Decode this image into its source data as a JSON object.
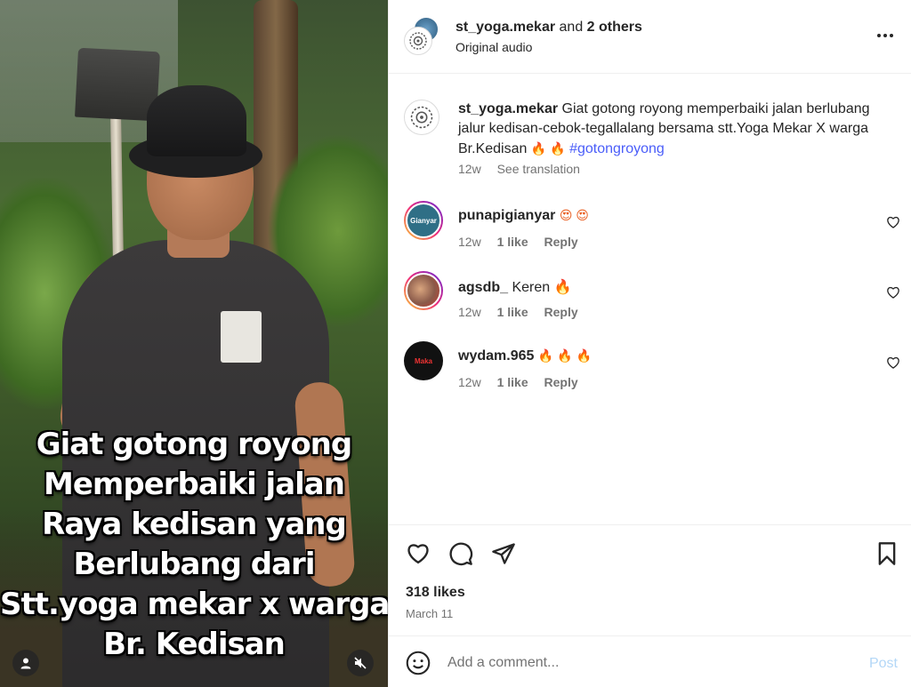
{
  "video": {
    "overlay_lines": [
      "Giat gotong royong",
      "Memperbaiki jalan",
      "Raya kedisan yang",
      "Berlubang dari",
      "Stt.yoga mekar x warga",
      "Br. Kedisan"
    ],
    "user_icon": "user-tag-icon",
    "mute_icon": "muted-speaker-icon"
  },
  "header": {
    "username": "st_yoga.mekar",
    "and_text": "and",
    "others": "2 others",
    "audio": "Original audio",
    "more_icon": "more-options-icon"
  },
  "caption": {
    "username": "st_yoga.mekar",
    "text": "Giat gotong royong memperbaiki jalan berlubang jalur kedisan-cebok-tegallalang bersama stt.Yoga Mekar X warga Br.Kedisan",
    "emoji": "🔥 🔥",
    "hashtag": "#gotongroyong",
    "time": "12w",
    "see_translation": "See translation"
  },
  "comments": [
    {
      "username": "punapigianyar",
      "text": "😍 😍",
      "time": "12w",
      "likes": "1 like",
      "reply": "Reply",
      "avatar_text": "Gianyar",
      "avatar_color": "#2f6f86"
    },
    {
      "username": "agsdb_",
      "text": "Keren 🔥",
      "time": "12w",
      "likes": "1 like",
      "reply": "Reply",
      "avatar_text": "",
      "avatar_color": "#8a5a4a"
    },
    {
      "username": "wydam.965",
      "text": "🔥 🔥 🔥",
      "time": "12w",
      "likes": "1 like",
      "reply": "Reply",
      "avatar_text": "Maka",
      "avatar_color": "#1a1a1a"
    }
  ],
  "actions": {
    "like_icon": "heart-icon",
    "comment_icon": "comment-bubble-icon",
    "share_icon": "paper-plane-icon",
    "save_icon": "bookmark-icon",
    "likes": "318 likes",
    "date": "March 11"
  },
  "add_comment": {
    "placeholder": "Add a comment...",
    "post": "Post",
    "emoji_icon": "emoji-smiley-icon"
  },
  "colors": {
    "hashtag": "#4a5df9",
    "muted_text": "#737373",
    "post_disabled": "#b3d7f7",
    "story_ring": "#ee2a7b"
  }
}
